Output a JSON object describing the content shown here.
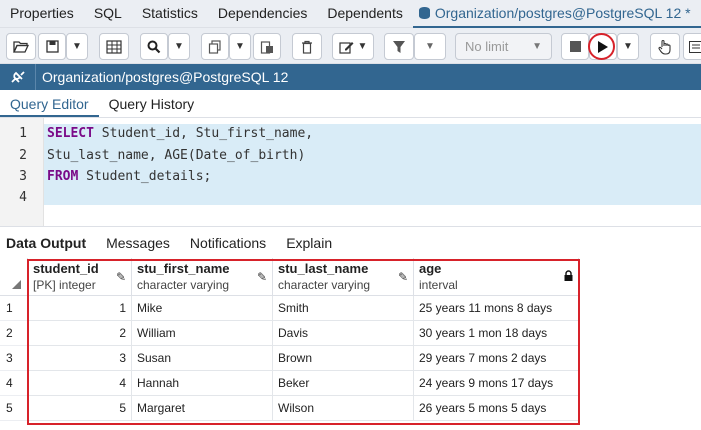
{
  "top_tabs": [
    {
      "label": "Properties"
    },
    {
      "label": "SQL"
    },
    {
      "label": "Statistics"
    },
    {
      "label": "Dependencies"
    },
    {
      "label": "Dependents"
    },
    {
      "label": "Organization/postgres@PostgreSQL 12 *",
      "active": true
    }
  ],
  "toolbar": {
    "limit_label": "No limit"
  },
  "connection": {
    "label": "Organization/postgres@PostgreSQL 12"
  },
  "editor_tabs": [
    {
      "label": "Query Editor",
      "active": true
    },
    {
      "label": "Query History"
    }
  ],
  "editor": {
    "line_numbers": [
      "1",
      "2",
      "3",
      "4"
    ],
    "line1_kw": "SELECT",
    "line1_rest": " Student_id, Stu_first_name,",
    "line2": "Stu_last_name, AGE(Date_of_birth)",
    "line3_kw": "FROM",
    "line3_rest": " Student_details;"
  },
  "output_tabs": [
    {
      "label": "Data Output",
      "active": true
    },
    {
      "label": "Messages"
    },
    {
      "label": "Notifications"
    },
    {
      "label": "Explain"
    }
  ],
  "grid": {
    "columns": [
      {
        "name": "student_id",
        "type": "[PK] integer",
        "icon": "pencil-icon"
      },
      {
        "name": "stu_first_name",
        "type": "character varying",
        "icon": "pencil-icon"
      },
      {
        "name": "stu_last_name",
        "type": "character varying",
        "icon": "pencil-icon"
      },
      {
        "name": "age",
        "type": "interval",
        "icon": "lock-icon"
      }
    ],
    "rows": [
      {
        "n": "1",
        "id": "1",
        "first": "Mike",
        "last": "Smith",
        "age": "25 years 11 mons 8 days"
      },
      {
        "n": "2",
        "id": "2",
        "first": "William",
        "last": "Davis",
        "age": "30 years 1 mon 18 days"
      },
      {
        "n": "3",
        "id": "3",
        "first": "Susan",
        "last": "Brown",
        "age": "29 years 7 mons 2 days"
      },
      {
        "n": "4",
        "id": "4",
        "first": "Hannah",
        "last": "Beker",
        "age": "24 years 9 mons 17 days"
      },
      {
        "n": "5",
        "id": "5",
        "first": "Margaret",
        "last": "Wilson",
        "age": "26 years 5 mons 5 days"
      }
    ]
  },
  "colors": {
    "accent": "#326690",
    "highlight": "#d7222a",
    "keyword": "#7a0a88"
  }
}
